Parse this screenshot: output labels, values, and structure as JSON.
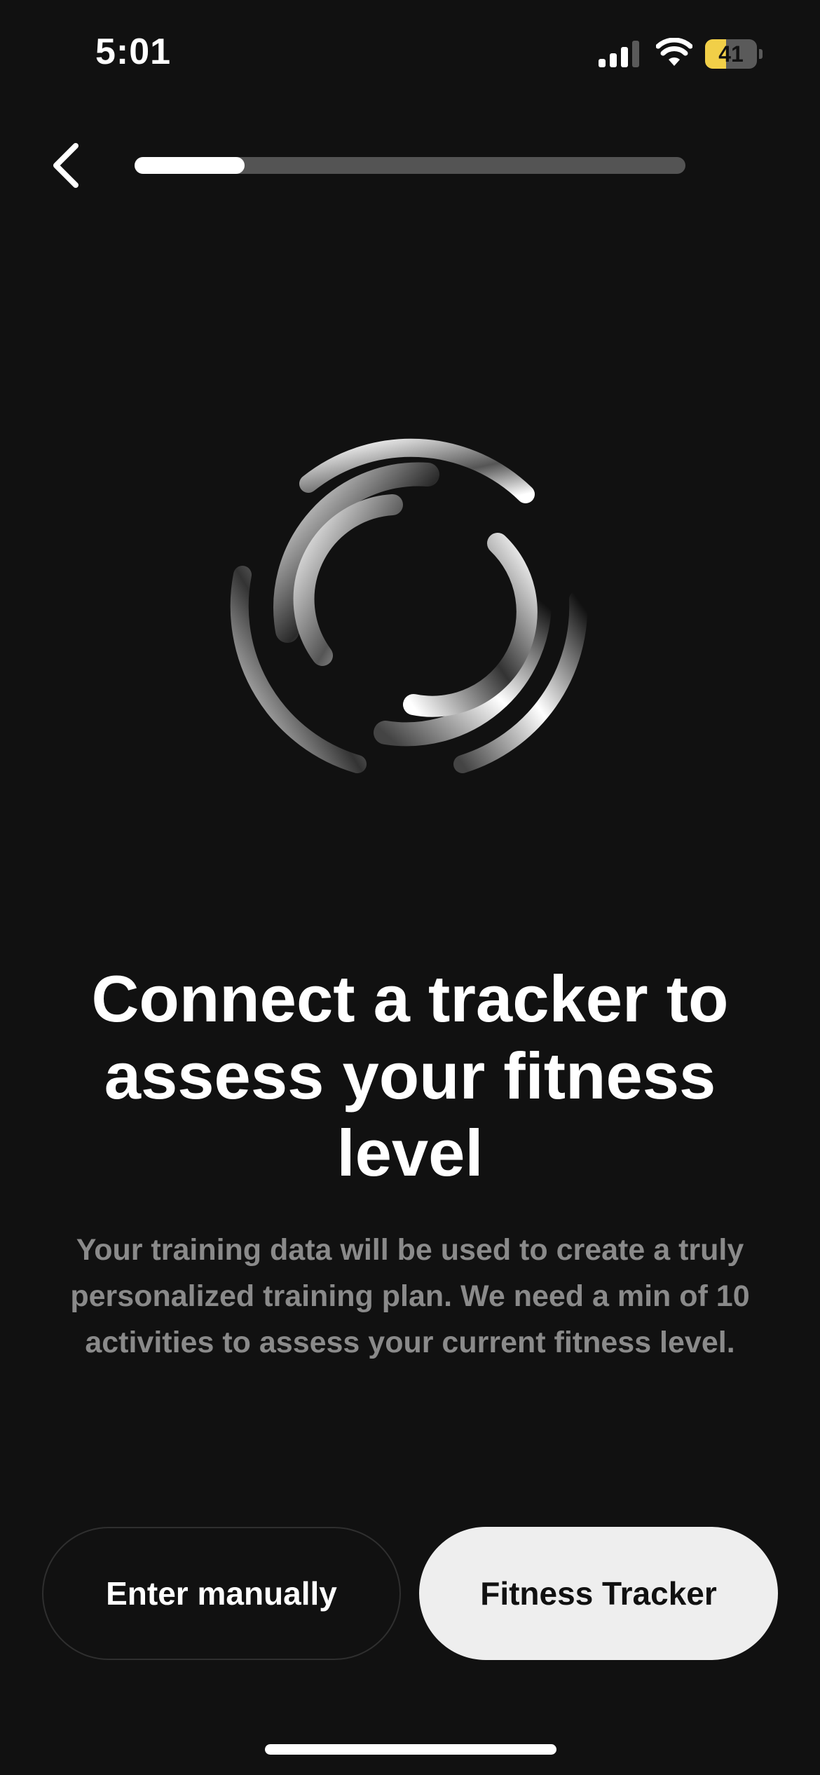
{
  "status_bar": {
    "time": "5:01",
    "battery_level": "41",
    "battery_fraction": 0.41,
    "icons": [
      "signal-icon",
      "wifi-icon",
      "battery-icon"
    ]
  },
  "header": {
    "back_icon": "chevron-left-icon",
    "progress_fraction": 0.2
  },
  "illustration": {
    "icon": "tracker-rings-icon"
  },
  "content": {
    "title": "Connect a tracker to assess your fitness level",
    "description": "Your training data will be used to create a truly personalized training plan. We need a min of 10 activities to assess your current fitness level."
  },
  "actions": {
    "manual_label": "Enter manually",
    "tracker_label": "Fitness Tracker"
  },
  "colors": {
    "background": "#111111",
    "primary_button_bg": "#eeeeee",
    "secondary_text": "#8a8a8a",
    "battery_yellow": "#f1cf48"
  }
}
